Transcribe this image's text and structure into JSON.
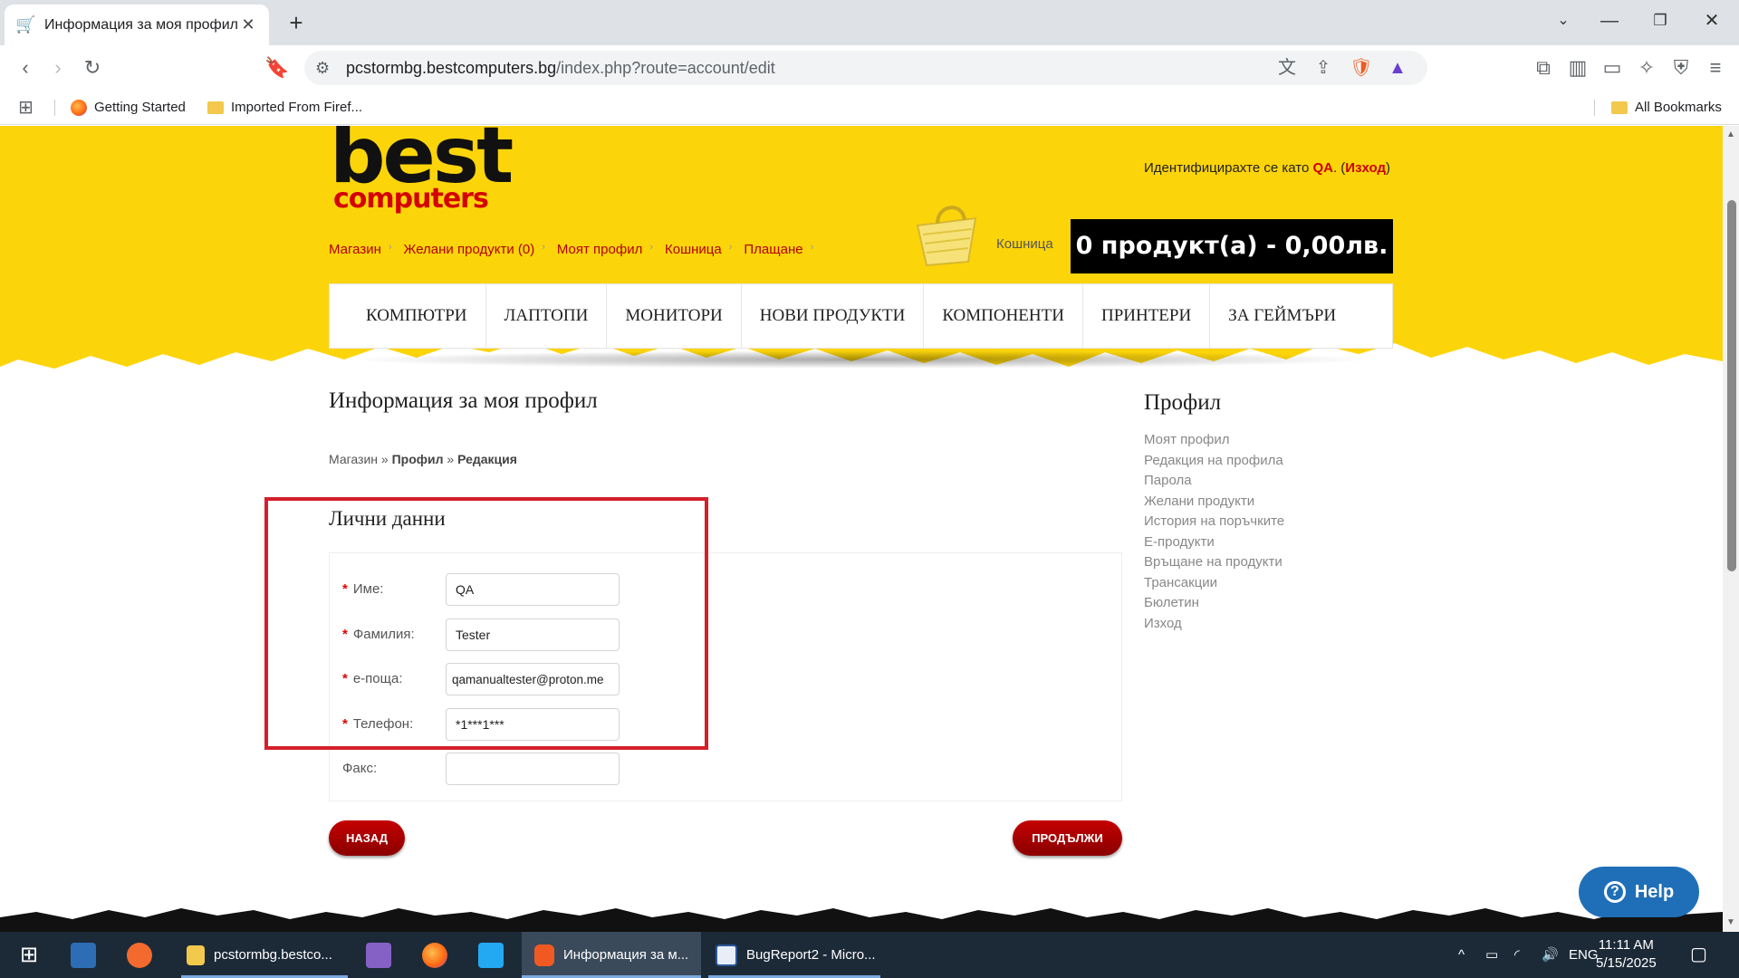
{
  "browser": {
    "tab_title": "Информация за моя профил",
    "tab_icon": "cart-icon",
    "url_host": "pcstormbg.bestcomputers.bg",
    "url_path": "/index.php?route=account/edit",
    "bookmarks": [
      "Getting Started",
      "Imported From Firef..."
    ],
    "all_bookmarks": "All Bookmarks"
  },
  "header": {
    "logo_top": "best",
    "logo_bottom": "computers",
    "welcome_prefix": "Идентифицирахте се като ",
    "welcome_user": "QA",
    "welcome_mid": ". (",
    "welcome_logout": "Изход",
    "welcome_suffix": ")",
    "top_links": [
      "Магазин",
      "Желани продукти (0)",
      "Моят профил",
      "Кошница",
      "Плащане"
    ],
    "cart_label": "Кошница",
    "cart_total": "0 продукт(а) - 0,00лв."
  },
  "categories": [
    "КОМПЮТРИ",
    "ЛАПТОПИ",
    "МОНИТОРИ",
    "НОВИ ПРОДУКТИ",
    "КОМПОНЕНТИ",
    "ПРИНТЕРИ",
    "ЗА ГЕЙМЪРИ"
  ],
  "main": {
    "title": "Информация за моя профил",
    "breadcrumb": {
      "home": "Магазин",
      "sep": " » ",
      "account": "Профил",
      "edit": "Редакция"
    },
    "section_title": "Лични данни",
    "fields": [
      {
        "label": "Име:",
        "required": true,
        "value": "QA"
      },
      {
        "label": "Фамилия:",
        "required": true,
        "value": "Tester"
      },
      {
        "label": "е-поща:",
        "required": true,
        "value": "qamanualtester@proton.me"
      },
      {
        "label": "Телефон:",
        "required": true,
        "value": "*1***1***"
      },
      {
        "label": "Факс:",
        "required": false,
        "value": ""
      }
    ],
    "back_button": "НАЗАД",
    "continue_button": "ПРОДЪЛЖИ"
  },
  "sidebar": {
    "title": "Профил",
    "items": [
      "Моят профил",
      "Редакция на профила",
      "Парола",
      "Желани продукти",
      "История на поръчките",
      "Е-продукти",
      "Връщане на продукти",
      "Трансакции",
      "Бюлетин",
      "Изход"
    ]
  },
  "help_button": "Help",
  "taskbar": {
    "apps": [
      {
        "label": "pcstormbg.bestco...",
        "icon": "file-explorer-icon"
      },
      {
        "label": "Информация за м...",
        "icon": "brave-browser-icon"
      },
      {
        "label": "BugReport2 - Micro...",
        "icon": "word-icon"
      }
    ],
    "lang": "ENG",
    "time": "11:11 AM",
    "date": "5/15/2025"
  },
  "colors": {
    "header_yellow": "#fcd40a",
    "accent_red": "#b30000",
    "highlight_red": "#d3202a",
    "help_blue": "#1f6fb8"
  }
}
